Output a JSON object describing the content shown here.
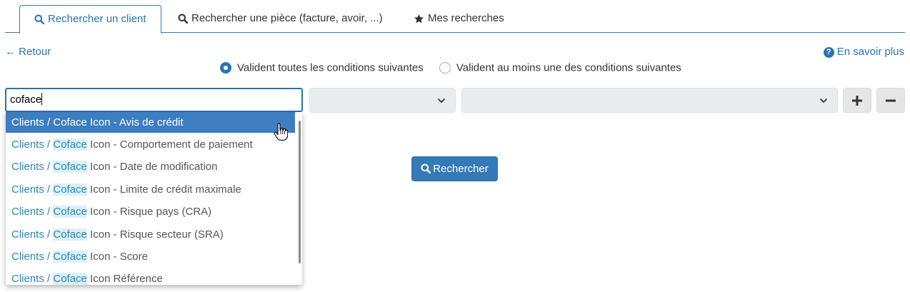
{
  "tabs": [
    {
      "label": "Rechercher un client",
      "icon": "search-icon",
      "active": true
    },
    {
      "label": "Rechercher une pièce (facture, avoir, ...)",
      "icon": "search-icon",
      "active": false
    },
    {
      "label": "Mes recherches",
      "icon": "star-icon",
      "active": false
    }
  ],
  "links": {
    "back": "← Retour",
    "help": "En savoir plus"
  },
  "conditions": {
    "all": "Valident toutes les conditions suivantes",
    "any": "Valident au moins une des conditions suivantes",
    "selected": "all"
  },
  "search": {
    "value": "coface"
  },
  "dropdown": {
    "category": "Clients /",
    "match": "Coface",
    "items": [
      {
        "rest": " Icon - Avis de crédit",
        "highlighted": true
      },
      {
        "rest": " Icon - Comportement de paiement",
        "highlighted": false
      },
      {
        "rest": " Icon - Date de modification",
        "highlighted": false
      },
      {
        "rest": " Icon - Limite de crédit maximale",
        "highlighted": false
      },
      {
        "rest": " Icon - Risque pays (CRA)",
        "highlighted": false
      },
      {
        "rest": " Icon - Risque secteur (SRA)",
        "highlighted": false
      },
      {
        "rest": " Icon - Score",
        "highlighted": false
      },
      {
        "rest": " Icon Référence",
        "highlighted": false
      }
    ]
  },
  "buttons": {
    "search": "Rechercher",
    "add": "plus-icon",
    "remove": "minus-icon"
  },
  "colors": {
    "primary": "#337ab7",
    "link": "#2a73b5",
    "highlight": "#3d7dc0",
    "match_bg": "#daf1f7"
  }
}
